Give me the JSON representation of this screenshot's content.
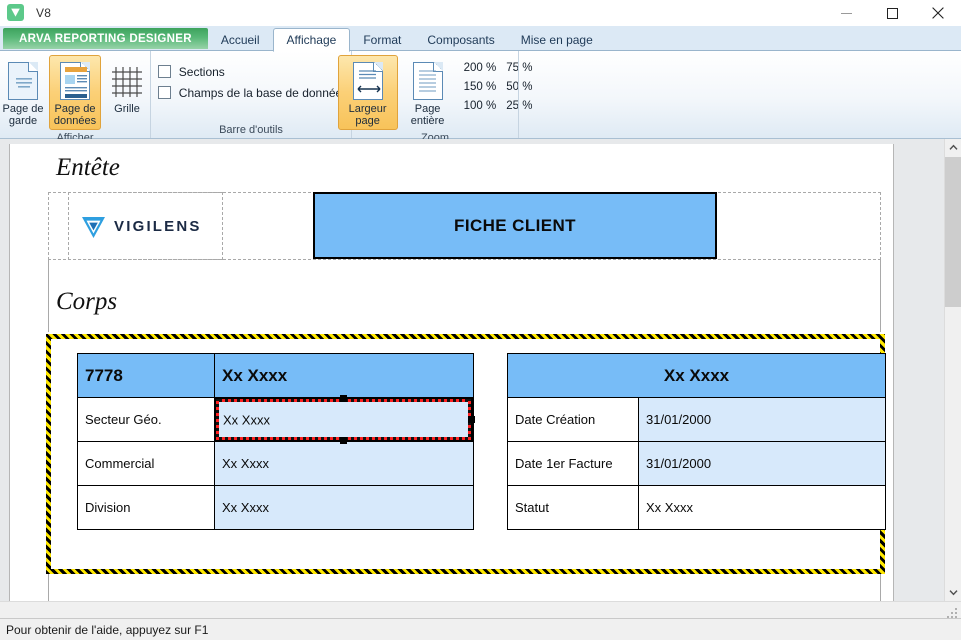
{
  "window": {
    "title": "V8",
    "app_icon": "vigilens-app-icon",
    "minimize_label": "Minimize",
    "maximize_label": "Maximize",
    "close_label": "Close"
  },
  "ribbon": {
    "product_tab": "ARVA REPORTING DESIGNER",
    "tabs": [
      {
        "label": "Accueil",
        "active": false
      },
      {
        "label": "Affichage",
        "active": true
      },
      {
        "label": "Format",
        "active": false
      },
      {
        "label": "Composants",
        "active": false
      },
      {
        "label": "Mise en page",
        "active": false
      }
    ],
    "groups": [
      {
        "name": "afficher",
        "label": "Afficher",
        "buttons": [
          {
            "label": "Page de\ngarde",
            "icon": "cover-page-icon",
            "checked": false
          },
          {
            "label": "Page de\ndonnées",
            "icon": "data-page-icon",
            "checked": true
          },
          {
            "label": "Grille",
            "icon": "grid-icon",
            "checked": false
          }
        ]
      },
      {
        "name": "barre-outils",
        "label": "Barre d'outils",
        "checkboxes": [
          {
            "label": "Sections",
            "checked": false
          },
          {
            "label": "Champs de la base de données",
            "checked": false
          }
        ]
      },
      {
        "name": "zoom",
        "label": "Zoom",
        "buttons": [
          {
            "label": "Largeur\npage",
            "icon": "page-width-icon",
            "checked": true
          },
          {
            "label": "Page\nentière",
            "icon": "whole-page-icon",
            "checked": false
          }
        ],
        "levels": [
          "200 %",
          "75 %",
          "150 %",
          "50 %",
          "100 %",
          "25 %"
        ]
      }
    ]
  },
  "document": {
    "sections": [
      {
        "label": "Entête"
      },
      {
        "label": "Corps"
      }
    ],
    "logo": {
      "text": "VIGILENS",
      "mark": "vigilens-chevron-icon"
    },
    "banner": {
      "text": "FICHE CLIENT"
    },
    "tables": [
      {
        "name": "client-info-table",
        "header": {
          "left": "7778",
          "right": "Xx Xxxx"
        },
        "rows": [
          {
            "label": "Secteur Géo.",
            "value": "Xx Xxxx",
            "selected": true,
            "value_filled": true
          },
          {
            "label": "Commercial",
            "value": "Xx Xxxx",
            "selected": false,
            "value_filled": true
          },
          {
            "label": "Division",
            "value": "Xx Xxxx",
            "selected": false,
            "value_filled": true
          }
        ]
      },
      {
        "name": "client-dates-table",
        "header": {
          "text": "Xx Xxxx"
        },
        "rows": [
          {
            "label": "Date Création",
            "value": "31/01/2000",
            "value_filled": true
          },
          {
            "label": "Date 1er Facture",
            "value": "31/01/2000",
            "value_filled": true
          },
          {
            "label": "Statut",
            "value": "Xx Xxxx",
            "value_filled": false
          }
        ]
      }
    ]
  },
  "status": {
    "message": "Pour obtenir de l'aide, appuyez sur F1"
  },
  "colors": {
    "accent_green": "#58b878",
    "banner_blue": "#77bcf7",
    "cell_blue": "#d7e9fb",
    "ribbon_checked": "#f8c35a",
    "selection_yellow": "#ffe800",
    "selection_red": "#ff2020"
  }
}
